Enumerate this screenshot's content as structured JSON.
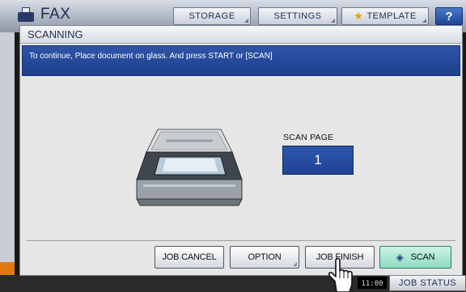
{
  "app": {
    "title": "FAX",
    "tabs": [
      {
        "label": "STORAGE"
      },
      {
        "label": "SETTINGS"
      },
      {
        "label": "TEMPLATE"
      }
    ],
    "help_label": "?",
    "clock": "11:00",
    "job_status_label": "JOB STATUS"
  },
  "dialog": {
    "title": "SCANNING",
    "message": "To continue, Place document on glass. And press START or [SCAN]",
    "scan_page_label": "SCAN PAGE",
    "scan_page_count": "1",
    "buttons": {
      "job_cancel": "JOB CANCEL",
      "option": "OPTION",
      "job_finish": "JOB FINISH",
      "scan": "SCAN"
    }
  },
  "colors": {
    "accent_blue": "#1f4395",
    "scan_button": "#8fdcc2",
    "orange": "#e07a10"
  },
  "icons": [
    "fax-icon",
    "star-icon",
    "scanner-illustration",
    "scan-diamond-icon",
    "hand-pointer-icon"
  ]
}
